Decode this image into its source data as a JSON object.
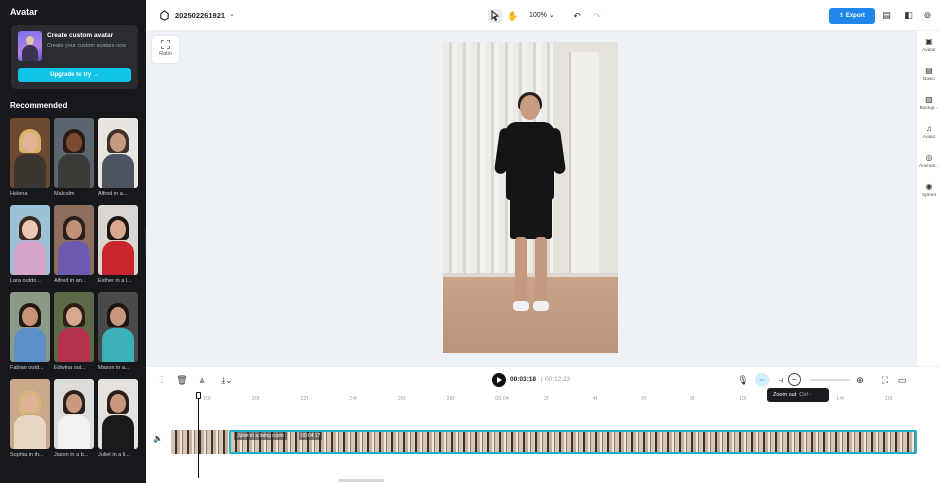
{
  "left_panel": {
    "title": "Avatar",
    "promo": {
      "title": "Create custom avatar",
      "subtitle": "Create your custom avatars now",
      "button_label": "Upgrade to try →"
    },
    "recommended_title": "Recommended",
    "avatars": [
      {
        "name": "Helena",
        "bg": "#6b4a2d",
        "skin": "#e1b49a",
        "hair": "#d9b36a",
        "top": "#3b3630"
      },
      {
        "name": "Malcolm",
        "bg": "#5c6470",
        "skin": "#7a4b32",
        "hair": "#2a1a14",
        "top": "#3d3b38"
      },
      {
        "name": "Alfred in a...",
        "bg": "#e9e6e2",
        "skin": "#c79b80",
        "hair": "#3c3029",
        "top": "#4c5560"
      },
      {
        "name": "Lara outdo...",
        "bg": "#9cc2d7",
        "skin": "#eac7b4",
        "hair": "#3b2a22",
        "top": "#d6a3c9"
      },
      {
        "name": "Alfred in an...",
        "bg": "#8d6d5e",
        "skin": "#c18e76",
        "hair": "#2a1f1a",
        "top": "#6b5ab0"
      },
      {
        "name": "Esther in a l...",
        "bg": "#dad7d3",
        "skin": "#d9a98d",
        "hair": "#1d1613",
        "top": "#c7262c"
      },
      {
        "name": "Fabian outd...",
        "bg": "#8a9a86",
        "skin": "#c69377",
        "hair": "#221814",
        "top": "#5b8fc8"
      },
      {
        "name": "Edwina out...",
        "bg": "#5d6a4a",
        "skin": "#d6a88c",
        "hair": "#2d1d15",
        "top": "#b4324b"
      },
      {
        "name": "Mason in a...",
        "bg": "#4b4a4a",
        "skin": "#c79a7e",
        "hair": "#1e1613",
        "top": "#3ab1b7"
      },
      {
        "name": "Sophia in th...",
        "bg": "#c8a98a",
        "skin": "#e0b398",
        "hair": "#d6b47a",
        "top": "#e8d7c4"
      },
      {
        "name": "Jason in a b...",
        "bg": "#dedcd8",
        "skin": "#c89b80",
        "hair": "#2b221d",
        "top": "#f2f2f2"
      },
      {
        "name": "Juliet in a li...",
        "bg": "#e5e2dd",
        "skin": "#c6987e",
        "hair": "#2b1f1c",
        "top": "#1a1a1a"
      }
    ]
  },
  "topbar": {
    "project_name": "202502261921",
    "zoom": "100%",
    "export_label": "Export"
  },
  "canvas": {
    "ratio_label": "Ratio"
  },
  "right_sidebar": [
    {
      "label": "Avatar",
      "icon": "avatar-icon"
    },
    {
      "label": "Basic",
      "icon": "basic-icon"
    },
    {
      "label": "Backgr...",
      "icon": "background-icon"
    },
    {
      "label": "Audio",
      "icon": "audio-icon"
    },
    {
      "label": "Animati...",
      "icon": "animation-icon"
    },
    {
      "label": "Speed",
      "icon": "speed-icon"
    }
  ],
  "timeline": {
    "current_time": "00:03:18",
    "separator": "|",
    "total_time": "00:12:23",
    "tooltip_label": "Zoom out",
    "tooltip_shortcut": "Ctrl -",
    "ruler_ticks": [
      "10f",
      "20f",
      "22f",
      "24f",
      "26f",
      "28f",
      "00:04",
      "2f",
      "4f",
      "6f",
      "8f",
      "10f",
      "12f",
      "14f",
      "16f"
    ],
    "clip_label": "Juliet in a living room",
    "clip_duration": "00:04:17"
  },
  "colors": {
    "accent": "#1f86ea",
    "teal": "#12c4e8",
    "dark_panel": "#16181c"
  }
}
